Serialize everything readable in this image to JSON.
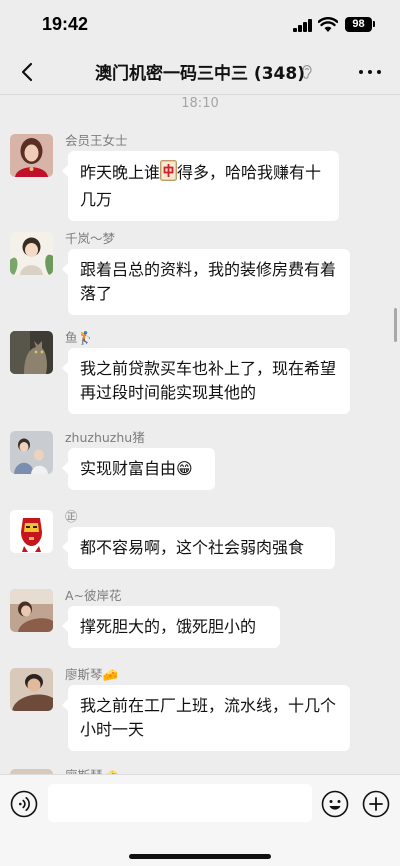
{
  "status_bar": {
    "time": "19:42",
    "battery": "98"
  },
  "header": {
    "title": "澳门机密一码三中三 (348)"
  },
  "timestamp": "18:10",
  "messages": [
    {
      "sender": "会员王女士",
      "text_before": "昨天晚上谁",
      "emoji": "🀄",
      "text_after": "得多，哈哈我赚有十几万"
    },
    {
      "sender": "千岚～梦",
      "text": "跟着吕总的资料，我的装修房费有着落了"
    },
    {
      "sender": "鱼🏌",
      "text": "我之前贷款买车也补上了，现在希望再过段时间能实现其他的"
    },
    {
      "sender": "zhuzhuzhu猪",
      "text": "实现财富自由😁"
    },
    {
      "sender": "㊣",
      "text": "都不容易啊，这个社会弱肉强食"
    },
    {
      "sender": "A~彼岸花",
      "text": "撑死胆大的，饿死胆小的"
    },
    {
      "sender": "廖斯琴🧀",
      "text": "我之前在工厂上班，流水线，十几个小时一天"
    },
    {
      "sender": "廖斯琴🧀"
    }
  ],
  "input": {
    "placeholder": ""
  },
  "icons": [
    "back-icon",
    "ear-icon",
    "more-icon",
    "voice-icon",
    "emoji-icon",
    "add-icon"
  ]
}
